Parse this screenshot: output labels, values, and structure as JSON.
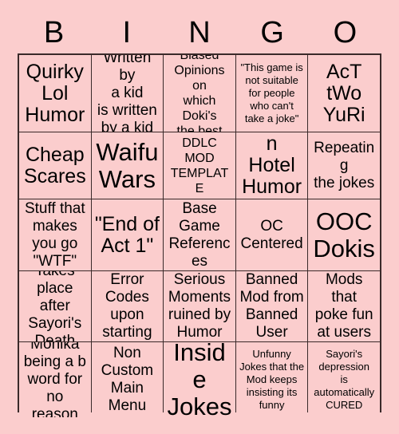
{
  "page": {
    "background_color": "#fbcdcd",
    "text_color": "#000000",
    "grid_line_color": "#3a2a2a"
  },
  "header": {
    "letters": [
      "B",
      "I",
      "N",
      "G",
      "O"
    ]
  },
  "grid": {
    "columns": 5,
    "rows": 5,
    "cells": [
      {
        "text": "Quirky\nLol\nHumor",
        "size": "lg"
      },
      {
        "text": "Written by\na kid\nis written\nby a kid",
        "size": "md"
      },
      {
        "text": "Biased\nOpinions on\nwhich Doki's\nthe best",
        "size": "sm"
      },
      {
        "text": "\"This game is\nnot suitable\nfor people\nwho can't\ntake a joke\"",
        "size": "xs"
      },
      {
        "text": "AcT\ntWo\nYuRi",
        "size": "lg"
      },
      {
        "text": "Cheap\nScares",
        "size": "lg"
      },
      {
        "text": "Waifu\nWars",
        "size": "xl"
      },
      {
        "text": "DDLC\nMOD\nTEMPLATE",
        "size": "sm"
      },
      {
        "text": "\"Hazbin\nHotel\nHumor\"",
        "size": "lg"
      },
      {
        "text": "Repeating\nthe jokes",
        "size": "md"
      },
      {
        "text": "Stuff that\nmakes\nyou go\n\"WTF\"",
        "size": "md"
      },
      {
        "text": "\"End of\nAct 1\"",
        "size": "lg"
      },
      {
        "text": "Base\nGame\nReferences",
        "size": "md"
      },
      {
        "text": "OC\nCentered",
        "size": "md"
      },
      {
        "text": "OOC\nDokis",
        "size": "xl"
      },
      {
        "text": "Takes\nplace after\nSayori's\nDeath",
        "size": "md"
      },
      {
        "text": "Error\nCodes\nupon\nstarting",
        "size": "md"
      },
      {
        "text": "Serious\nMoments\nruined by\nHumor",
        "size": "md"
      },
      {
        "text": "Banned\nMod from\nBanned\nUser",
        "size": "md"
      },
      {
        "text": "Mods that\npoke fun\nat users",
        "size": "md"
      },
      {
        "text": "Monika\nbeing a b\nword for\nno reason",
        "size": "md"
      },
      {
        "text": "Non\nCustom\nMain\nMenu",
        "size": "md"
      },
      {
        "text": "Inside\nJokes",
        "size": "xl"
      },
      {
        "text": "Unfunny\nJokes that the\nMod keeps\ninsisting its\nfunny",
        "size": "xs"
      },
      {
        "text": "Sayori's\ndepression\nis\nautomatically\nCURED",
        "size": "xs"
      }
    ]
  }
}
